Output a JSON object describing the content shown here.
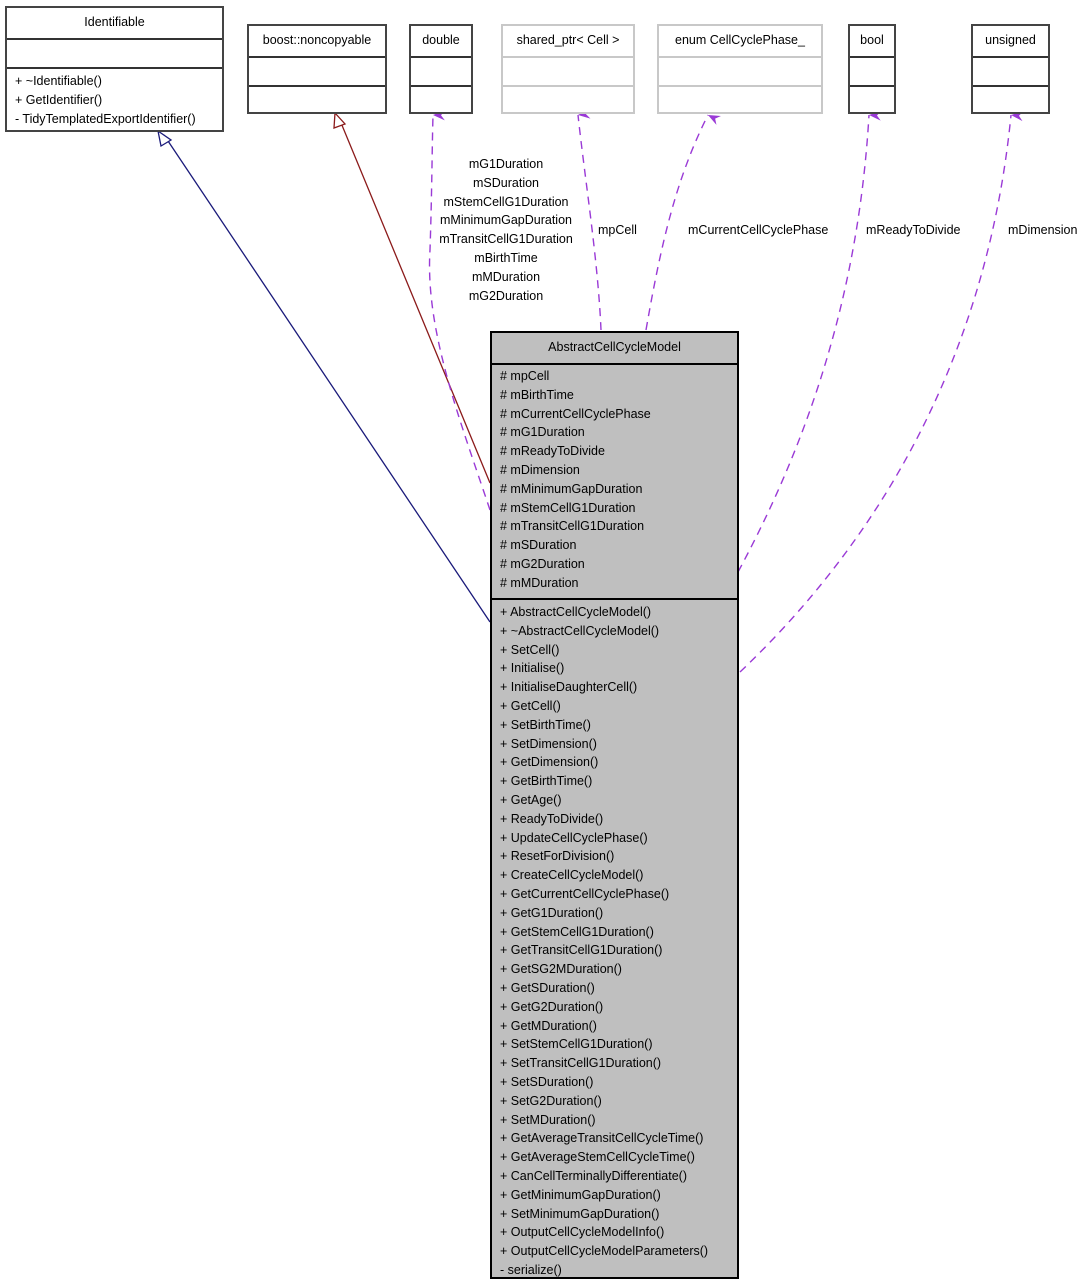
{
  "diagram": {
    "type": "uml-class-collaboration",
    "colors": {
      "inheritance_public": "#1a1a7a",
      "inheritance_private": "#8b1a1a",
      "usage": "#9a3ad6",
      "main_fill": "#bfbfbf",
      "node_border": "#444444",
      "undocumented_border": "#c8c8c8"
    },
    "classes": {
      "identifiable": {
        "name": "Identifiable",
        "attributes": [],
        "methods": [
          "+ ~Identifiable()",
          "+ GetIdentifier()",
          "- TidyTemplatedExportIdentifier()"
        ]
      },
      "noncopyable": {
        "name": "boost::noncopyable",
        "attributes": [],
        "methods": []
      },
      "double": {
        "name": "double",
        "attributes": [],
        "methods": []
      },
      "shared_ptr": {
        "name": "shared_ptr< Cell >",
        "attributes": [],
        "methods": []
      },
      "enum_phase": {
        "name": "enum CellCyclePhase_",
        "attributes": [],
        "methods": []
      },
      "bool": {
        "name": "bool",
        "attributes": [],
        "methods": []
      },
      "unsigned": {
        "name": "unsigned",
        "attributes": [],
        "methods": []
      },
      "main": {
        "name": "AbstractCellCycleModel",
        "attributes": [
          "# mpCell",
          "# mBirthTime",
          "# mCurrentCellCyclePhase",
          "# mG1Duration",
          "# mReadyToDivide",
          "# mDimension",
          "# mMinimumGapDuration",
          "# mStemCellG1Duration",
          "# mTransitCellG1Duration",
          "# mSDuration",
          "# mG2Duration",
          "# mMDuration"
        ],
        "methods": [
          "+ AbstractCellCycleModel()",
          "+ ~AbstractCellCycleModel()",
          "+ SetCell()",
          "+ Initialise()",
          "+ InitialiseDaughterCell()",
          "+ GetCell()",
          "+ SetBirthTime()",
          "+ SetDimension()",
          "+ GetDimension()",
          "+ GetBirthTime()",
          "+ GetAge()",
          "+ ReadyToDivide()",
          "+ UpdateCellCyclePhase()",
          "+ ResetForDivision()",
          "+ CreateCellCycleModel()",
          "+ GetCurrentCellCyclePhase()",
          "+ GetG1Duration()",
          "+ GetStemCellG1Duration()",
          "+ GetTransitCellG1Duration()",
          "+ GetSG2MDuration()",
          "+ GetSDuration()",
          "+ GetG2Duration()",
          "+ GetMDuration()",
          "+ SetStemCellG1Duration()",
          "+ SetTransitCellG1Duration()",
          "+ SetSDuration()",
          "+ SetG2Duration()",
          "+ SetMDuration()",
          "+ GetAverageTransitCellCycleTime()",
          "+ GetAverageStemCellCycleTime()",
          "+ CanCellTerminallyDifferentiate()",
          "+ GetMinimumGapDuration()",
          "+ SetMinimumGapDuration()",
          "+ OutputCellCycleModelInfo()",
          "+ OutputCellCycleModelParameters()",
          "- serialize()"
        ]
      }
    },
    "edges": [
      {
        "from": "main",
        "to": "identifiable",
        "kind": "public-inheritance",
        "labels": []
      },
      {
        "from": "main",
        "to": "noncopyable",
        "kind": "private-inheritance",
        "labels": []
      },
      {
        "from": "main",
        "to": "double",
        "kind": "usage",
        "labels": [
          "mG1Duration",
          "mSDuration",
          "mStemCellG1Duration",
          "mMinimumGapDuration",
          "mTransitCellG1Duration",
          "mBirthTime",
          "mMDuration",
          "mG2Duration"
        ]
      },
      {
        "from": "main",
        "to": "shared_ptr",
        "kind": "usage",
        "labels": [
          "mpCell"
        ]
      },
      {
        "from": "main",
        "to": "enum_phase",
        "kind": "usage",
        "labels": [
          "mCurrentCellCyclePhase"
        ]
      },
      {
        "from": "main",
        "to": "bool",
        "kind": "usage",
        "labels": [
          "mReadyToDivide"
        ]
      },
      {
        "from": "main",
        "to": "unsigned",
        "kind": "usage",
        "labels": [
          "mDimension"
        ]
      }
    ]
  }
}
